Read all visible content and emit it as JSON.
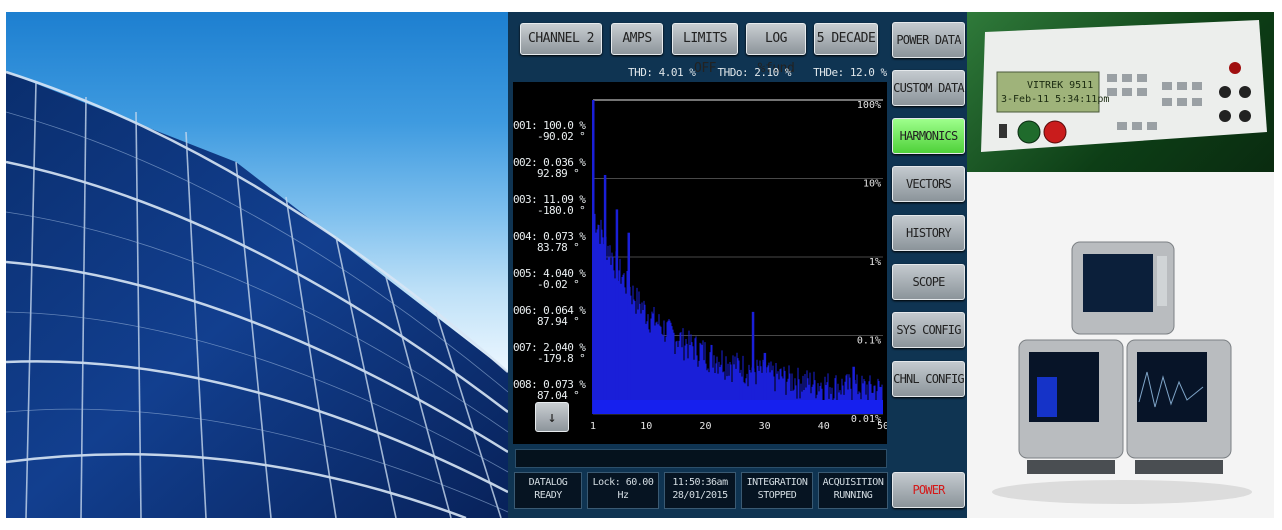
{
  "top_buttons": [
    {
      "label": "CHANNEL 2"
    },
    {
      "label": "AMPS"
    },
    {
      "label": "LIMITS OFF"
    },
    {
      "label": "LOG %fund"
    },
    {
      "label": "5 DECADE"
    }
  ],
  "info_line": [
    "THD: 4.01 %",
    "THDo: 2.10 %",
    "THDe: 12.0 %"
  ],
  "harmonics": [
    {
      "num": "001:",
      "pct": "100.0 %",
      "phase": "-90.02 °"
    },
    {
      "num": "002:",
      "pct": "0.036 %",
      "phase": "92.89 °"
    },
    {
      "num": "003:",
      "pct": "11.09 %",
      "phase": "-180.0 °"
    },
    {
      "num": "004:",
      "pct": "0.073 %",
      "phase": "83.78 °"
    },
    {
      "num": "005:",
      "pct": "4.040 %",
      "phase": "-0.02 °"
    },
    {
      "num": "006:",
      "pct": "0.064 %",
      "phase": "87.94 °"
    },
    {
      "num": "007:",
      "pct": "2.040 %",
      "phase": "-179.8 °"
    },
    {
      "num": "008:",
      "pct": "0.073 %",
      "phase": "87.04 °"
    }
  ],
  "down_button": "↓",
  "y_axis_labels": [
    "100%",
    "10%",
    "1%",
    "0.1%",
    "0.01%"
  ],
  "x_axis_labels": [
    "1",
    "10",
    "20",
    "30",
    "40",
    "50"
  ],
  "chart_data": {
    "type": "bar",
    "title": "",
    "xlabel": "",
    "ylabel": "",
    "scale": "log",
    "ylim_percent": [
      0.01,
      100
    ],
    "xlim": [
      1,
      50
    ],
    "peaks": [
      {
        "harmonic": 1,
        "value_percent": 100.0
      },
      {
        "harmonic": 3,
        "value_percent": 11.09
      },
      {
        "harmonic": 5,
        "value_percent": 4.04
      },
      {
        "harmonic": 7,
        "value_percent": 2.04
      },
      {
        "harmonic": 26,
        "value_percent": 0.03
      },
      {
        "harmonic": 28,
        "value_percent": 0.2
      },
      {
        "harmonic": 30,
        "value_percent": 0.06
      },
      {
        "harmonic": 45,
        "value_percent": 0.04
      }
    ],
    "series_color": "#1a1fd8"
  },
  "status_cells": [
    {
      "line1": "DATALOG",
      "line2": "READY"
    },
    {
      "line1": "Lock: 60.00 Hz",
      "line2": ""
    },
    {
      "line1": "11:50:36am",
      "line2": "28/01/2015"
    },
    {
      "line1": "INTEGRATION",
      "line2": "STOPPED"
    },
    {
      "line1": "ACQUISITION",
      "line2": "RUNNING"
    }
  ],
  "side_menu": [
    {
      "label": "POWER DATA",
      "active": false
    },
    {
      "label": "CUSTOM DATA",
      "active": false
    },
    {
      "label": "HARMONICS",
      "active": true
    },
    {
      "label": "VECTORS",
      "active": false
    },
    {
      "label": "HISTORY",
      "active": false
    },
    {
      "label": "SCOPE",
      "active": false
    },
    {
      "label": "SYS CONFIG",
      "active": false
    },
    {
      "label": "CHNL CONFIG",
      "active": false
    }
  ],
  "power_button": "POWER",
  "device_display": {
    "line1": "VITREK 9511",
    "line2": "3-Feb-11  5:34:11pm"
  },
  "colors": {
    "screen_bg": "#0f3452",
    "active_button": "#6ee05a",
    "power_text": "#d41919",
    "bars": "#1a1fd8"
  }
}
